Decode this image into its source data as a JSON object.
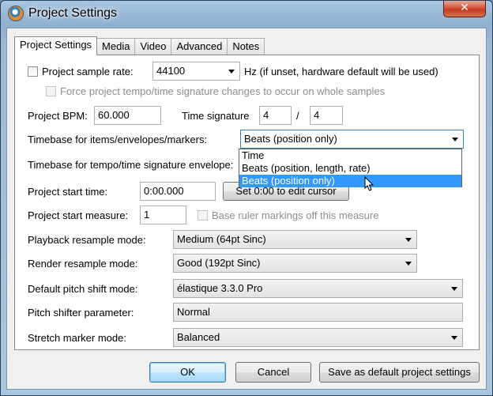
{
  "window": {
    "title": "Project Settings",
    "close_glyph": "✕"
  },
  "tabs": [
    "Project Settings",
    "Media",
    "Video",
    "Advanced",
    "Notes"
  ],
  "sample_rate": {
    "label": "Project sample rate:",
    "checked": false,
    "value": "44100",
    "hint": "Hz (if unset, hardware default will be used)"
  },
  "force_tempo": {
    "label": "Force project tempo/time signature changes to occur on whole samples",
    "checked": false,
    "disabled": true
  },
  "bpm": {
    "label": "Project BPM:",
    "value": "60.000"
  },
  "time_signature": {
    "label": "Time signature",
    "numerator": "4",
    "separator": "/",
    "denominator": "4"
  },
  "timebase_items": {
    "label": "Timebase for items/envelopes/markers:",
    "value": "Beats (position only)",
    "options": [
      "Time",
      "Beats (position, length, rate)",
      "Beats (position only)"
    ],
    "selected_index": 2
  },
  "timebase_tempo": {
    "label": "Timebase for tempo/time signature envelope:"
  },
  "start_time": {
    "label": "Project start time:",
    "value": "0:00.000",
    "button": "Set 0:00 to edit cursor"
  },
  "start_measure": {
    "label": "Project start measure:",
    "value": "1",
    "base_ruler_label": "Base ruler markings off this measure",
    "base_ruler_checked": false
  },
  "playback_resample": {
    "label": "Playback resample mode:",
    "value": "Medium (64pt Sinc)"
  },
  "render_resample": {
    "label": "Render resample mode:",
    "value": "Good (192pt Sinc)"
  },
  "pitch_shift_mode": {
    "label": "Default pitch shift mode:",
    "value": "élastique 3.3.0 Pro"
  },
  "pitch_shifter_param": {
    "label": "Pitch shifter parameter:",
    "value": "Normal"
  },
  "stretch_marker_mode": {
    "label": "Stretch marker mode:",
    "value": "Balanced"
  },
  "buttons": {
    "ok": "OK",
    "cancel": "Cancel",
    "save_default": "Save as default project settings"
  },
  "colors": {
    "selection": "#3399ff",
    "focus_border": "#3c7fb1",
    "close_button": "#c8432a"
  },
  "icons": {
    "app": "reaper-app-icon",
    "cursor": "mouse-pointer-icon"
  }
}
